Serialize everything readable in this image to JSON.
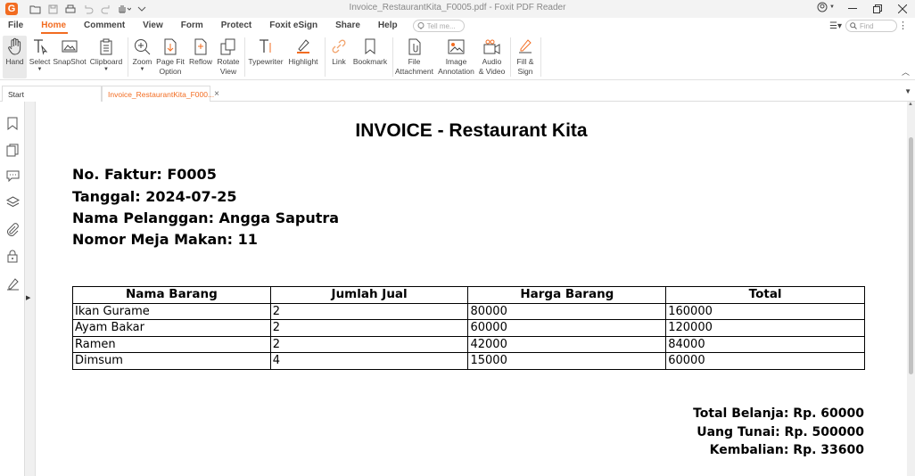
{
  "window": {
    "title": "Invoice_RestaurantKita_F0005.pdf - Foxit PDF Reader",
    "logo": "G"
  },
  "menu": {
    "tabs": [
      "File",
      "Home",
      "Comment",
      "View",
      "Form",
      "Protect",
      "Foxit eSign",
      "Share",
      "Help"
    ],
    "active_tab": "Home",
    "tellme_placeholder": "Tell me...",
    "find_placeholder": "Find"
  },
  "ribbon": {
    "hand": "Hand",
    "select": "Select",
    "snapshot": "SnapShot",
    "clipboard": "Clipboard",
    "zoom": "Zoom",
    "page_fit_l1": "Page Fit",
    "page_fit_l2": "Option",
    "reflow": "Reflow",
    "rotate_l1": "Rotate",
    "rotate_l2": "View",
    "typewriter": "Typewriter",
    "highlight": "Highlight",
    "link": "Link",
    "bookmark": "Bookmark",
    "file_attach_l1": "File",
    "file_attach_l2": "Attachment",
    "image_annot_l1": "Image",
    "image_annot_l2": "Annotation",
    "audio_l1": "Audio",
    "audio_l2": "& Video",
    "fill_l1": "Fill &",
    "fill_l2": "Sign"
  },
  "doc_tabs": {
    "start": "Start",
    "current": "Invoice_RestaurantKita_F000..."
  },
  "colors": {
    "accent": "#f26c21"
  },
  "invoice": {
    "title": "INVOICE - Restaurant Kita",
    "no_faktur": "No. Faktur: F0005",
    "tanggal": "Tanggal: 2024-07-25",
    "pelanggan": "Nama Pelanggan: Angga Saputra",
    "meja": "Nomor Meja Makan: 11",
    "headers": [
      "Nama Barang",
      "Jumlah Jual",
      "Harga Barang",
      "Total"
    ],
    "rows": [
      [
        "Ikan Gurame",
        "2",
        "80000",
        "160000"
      ],
      [
        "Ayam Bakar",
        "2",
        "60000",
        "120000"
      ],
      [
        "Ramen",
        "2",
        "42000",
        "84000"
      ],
      [
        "Dimsum",
        "4",
        "15000",
        "60000"
      ]
    ],
    "total_belanja": "Total Belanja: Rp. 60000",
    "uang_tunai": "Uang Tunai: Rp. 500000",
    "kembalian": "Kembalian: Rp. 33600"
  }
}
